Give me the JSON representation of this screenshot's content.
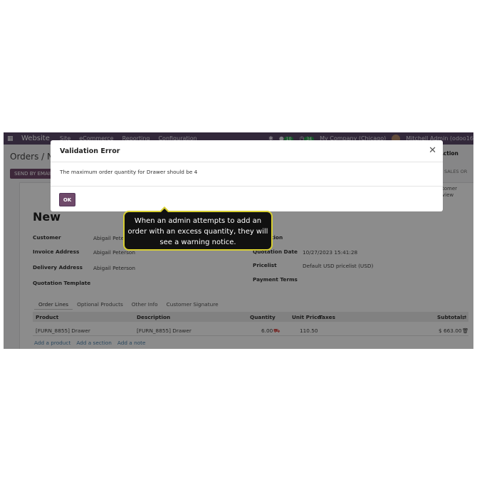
{
  "navbar": {
    "apps_icon": "grid-icon",
    "brand": "Website",
    "menus": [
      "Site",
      "eCommerce",
      "Reporting",
      "Configuration"
    ],
    "badge_messages": "10",
    "badge_activities": "34",
    "company": "My Company (Chicago)",
    "user": "Mitchell Admin (odoo16"
  },
  "control_panel": {
    "breadcrumb": "Orders / New",
    "send_by_email": "SEND BY EMAIL",
    "action": "Action",
    "status": "SALES OR"
  },
  "sheet": {
    "smart_button": [
      "tomer",
      "view"
    ],
    "title": "New",
    "fields_left": [
      {
        "label": "Customer",
        "value": "Abigail Peterson"
      },
      {
        "label": "Invoice Address",
        "value": "Abigail Peterson"
      },
      {
        "label": "Delivery Address",
        "value": "Abigail Peterson"
      },
      {
        "label": "Quotation Template",
        "value": ""
      }
    ],
    "fields_right": [
      {
        "label": "Expiration",
        "value": ""
      },
      {
        "label": "Quotation Date",
        "value": "10/27/2023 15:41:28"
      },
      {
        "label": "Pricelist",
        "value": "Default USD pricelist (USD)"
      },
      {
        "label": "Payment Terms",
        "value": ""
      }
    ],
    "tabs": [
      "Order Lines",
      "Optional Products",
      "Other Info",
      "Customer Signature"
    ],
    "table_headers": [
      "Product",
      "Description",
      "Quantity",
      "Unit Price",
      "Taxes",
      "Subtotal"
    ],
    "row": {
      "product": "[FURN_8855] Drawer",
      "description": "[FURN_8855] Drawer",
      "quantity": "6.00",
      "unit_price": "110.50",
      "subtotal": "$ 663.00"
    },
    "add_links": [
      "Add a product",
      "Add a section",
      "Add a note"
    ]
  },
  "dialog": {
    "title": "Validation Error",
    "message": "The maximum order quantity for Drawer should be 4",
    "ok_label": "OK"
  },
  "tooltip": {
    "text": "When an admin attempts to add an order with an excess quantity, they will see a warning notice."
  },
  "colors": {
    "navbar": "#5b4a6b",
    "primary_button": "#6f4a6a",
    "tooltip_border": "#d8cf32",
    "link": "#4b7fa8"
  }
}
